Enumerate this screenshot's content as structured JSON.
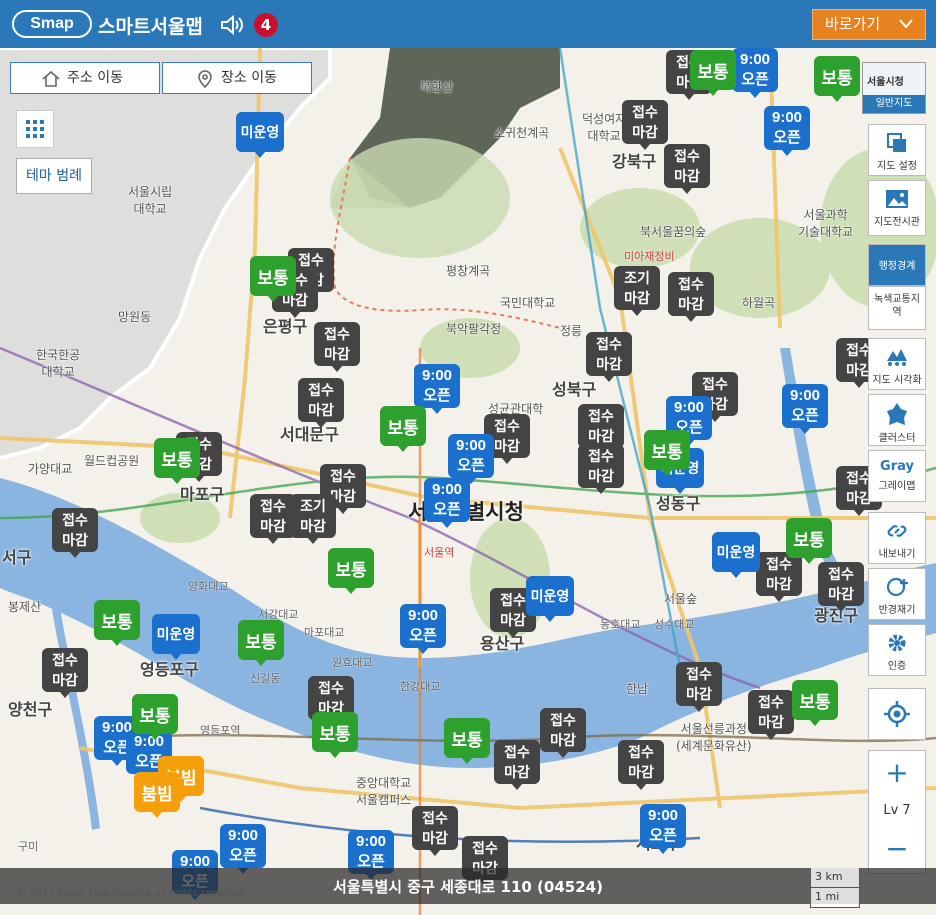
{
  "header": {
    "logo": "Smap",
    "title": "스마트서울맵",
    "notification_count": "4",
    "shortcut_label": "바로가기"
  },
  "controls": {
    "address_move": "주소 이동",
    "place_move": "장소 이동",
    "theme_legend": "테마 범례"
  },
  "toolbar": {
    "basemap_top": "서울시청",
    "basemap_caption": "일반지도",
    "items": [
      {
        "label": "지도 설정",
        "icon": "copy-layers-icon"
      },
      {
        "label": "지도전시관",
        "icon": "image-icon"
      },
      {
        "label": "행정경계",
        "icon": "admin-boundary-icon"
      },
      {
        "label": "녹색교통지역",
        "icon": "green-zone-icon"
      },
      {
        "label": "지도 시각화",
        "icon": "visualization-icon"
      },
      {
        "label": "클러스터",
        "icon": "cluster-icon"
      },
      {
        "label": "그레이맵",
        "icon": "gray-map-icon",
        "glyph": "Gray"
      },
      {
        "label": "내보내기",
        "icon": "link-icon"
      },
      {
        "label": "반경재기",
        "icon": "radius-icon"
      },
      {
        "label": "인증",
        "icon": "gear-icon"
      }
    ],
    "zoom_level": "Lv 7",
    "zoom_in": "+",
    "zoom_out": "−"
  },
  "map": {
    "city_hall": "서울특별시청",
    "districts": [
      "은평구",
      "서대문구",
      "마포구",
      "강북구",
      "성북구",
      "성동구",
      "용산구",
      "영등포구",
      "양천구",
      "광진구",
      "서초구",
      "서구"
    ],
    "places": [
      "북한산",
      "서울시립\n대학교",
      "망원동",
      "한국한공\n대학교",
      "월드컵공원",
      "가양대교",
      "봉제산",
      "양화대교",
      "서강대교",
      "마포대교",
      "원효대교",
      "한강대교",
      "한남",
      "서울숲",
      "동호대교",
      "성수대교",
      "국민대학교",
      "북악팔각정",
      "평창계곡",
      "소귀천계곡",
      "덕성여자\n대학교",
      "성균관대학",
      "서울과학\n기술대학교",
      "북서울꿈의숲",
      "미아재정비",
      "하월곡",
      "정릉",
      "서울선릉과정\n(세계문화유산)",
      "중앙대학교\n서울캠퍼스",
      "서울역",
      "영등포역",
      "신길동",
      "구미"
    ],
    "markers": [
      {
        "type": "blue",
        "text": "미운영"
      },
      {
        "type": "blue",
        "text": "9:00\n오픈"
      },
      {
        "type": "green",
        "text": "보통"
      },
      {
        "type": "orange",
        "text": "붐빔"
      },
      {
        "type": "dark",
        "text": "접수\n마감"
      },
      {
        "type": "dark",
        "text": "조기\n마감"
      }
    ]
  },
  "footer": {
    "address": "서울특별시 중구 세종대로 110 (04524)",
    "copyright": "© 2017 Seoul Map-Tagging all rights reserved.",
    "scale_km": "3 km",
    "scale_mi": "1 mi"
  },
  "colors": {
    "header": "#2b78b8",
    "shortcut": "#e8821f",
    "marker_dark": "#444444",
    "marker_blue": "#1b6fcd",
    "marker_green": "#2da02d",
    "marker_orange": "#f5a00a"
  }
}
